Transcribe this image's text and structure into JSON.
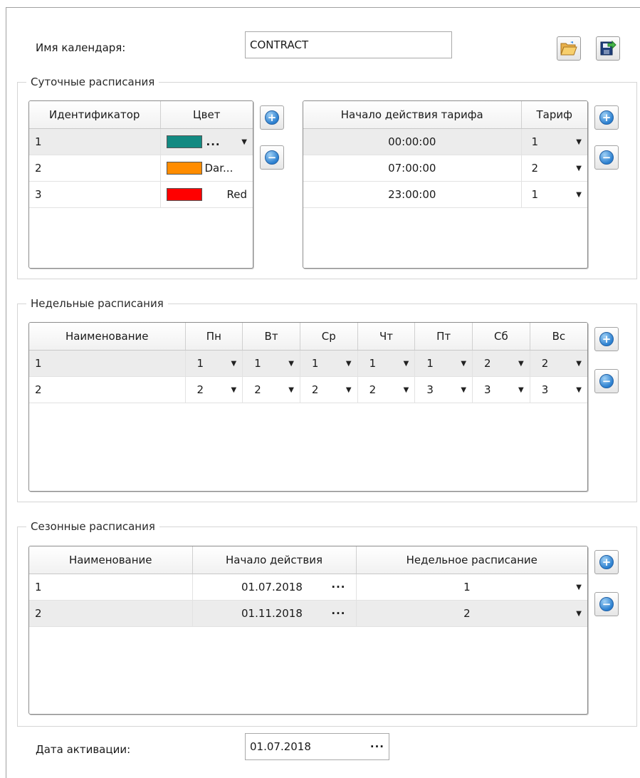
{
  "calendar": {
    "name_label": "Имя календаря:",
    "name_value": "CONTRACT"
  },
  "toolbar": {
    "open_icon": "folder-open-icon",
    "export_icon": "export-icon"
  },
  "daily": {
    "title": "Суточные расписания",
    "colors_table": {
      "headers": [
        "Идентификатор",
        "Цвет"
      ],
      "rows": [
        {
          "id": "1",
          "color_hex": "#138a82",
          "color_text": "..."
        },
        {
          "id": "2",
          "color_hex": "#ff8c00",
          "color_text": "Dar..."
        },
        {
          "id": "3",
          "color_hex": "#ff0000",
          "color_text": "Red"
        }
      ]
    },
    "tariff_table": {
      "headers": [
        "Начало действия тарифа",
        "Тариф"
      ],
      "rows": [
        {
          "start": "00:00:00",
          "tariff": "1"
        },
        {
          "start": "07:00:00",
          "tariff": "2"
        },
        {
          "start": "23:00:00",
          "tariff": "1"
        }
      ]
    }
  },
  "weekly": {
    "title": "Недельные расписания",
    "headers": [
      "Наименование",
      "Пн",
      "Вт",
      "Ср",
      "Чт",
      "Пт",
      "Сб",
      "Вс"
    ],
    "rows": [
      {
        "name": "1",
        "days": [
          "1",
          "1",
          "1",
          "1",
          "1",
          "2",
          "2"
        ]
      },
      {
        "name": "2",
        "days": [
          "2",
          "2",
          "2",
          "2",
          "3",
          "3",
          "3"
        ]
      }
    ]
  },
  "seasonal": {
    "title": "Сезонные расписания",
    "headers": [
      "Наименование",
      "Начало действия",
      "Недельное расписание"
    ],
    "rows": [
      {
        "name": "1",
        "start": "01.07.2018",
        "weekly": "1"
      },
      {
        "name": "2",
        "start": "01.11.2018",
        "weekly": "2"
      }
    ]
  },
  "activation": {
    "label": "Дата активации:",
    "value": "01.07.2018",
    "ellipsis": "···"
  },
  "symbols": {
    "plus": "+",
    "minus": "−",
    "dropdown": "▼",
    "ellipsis": "···"
  }
}
